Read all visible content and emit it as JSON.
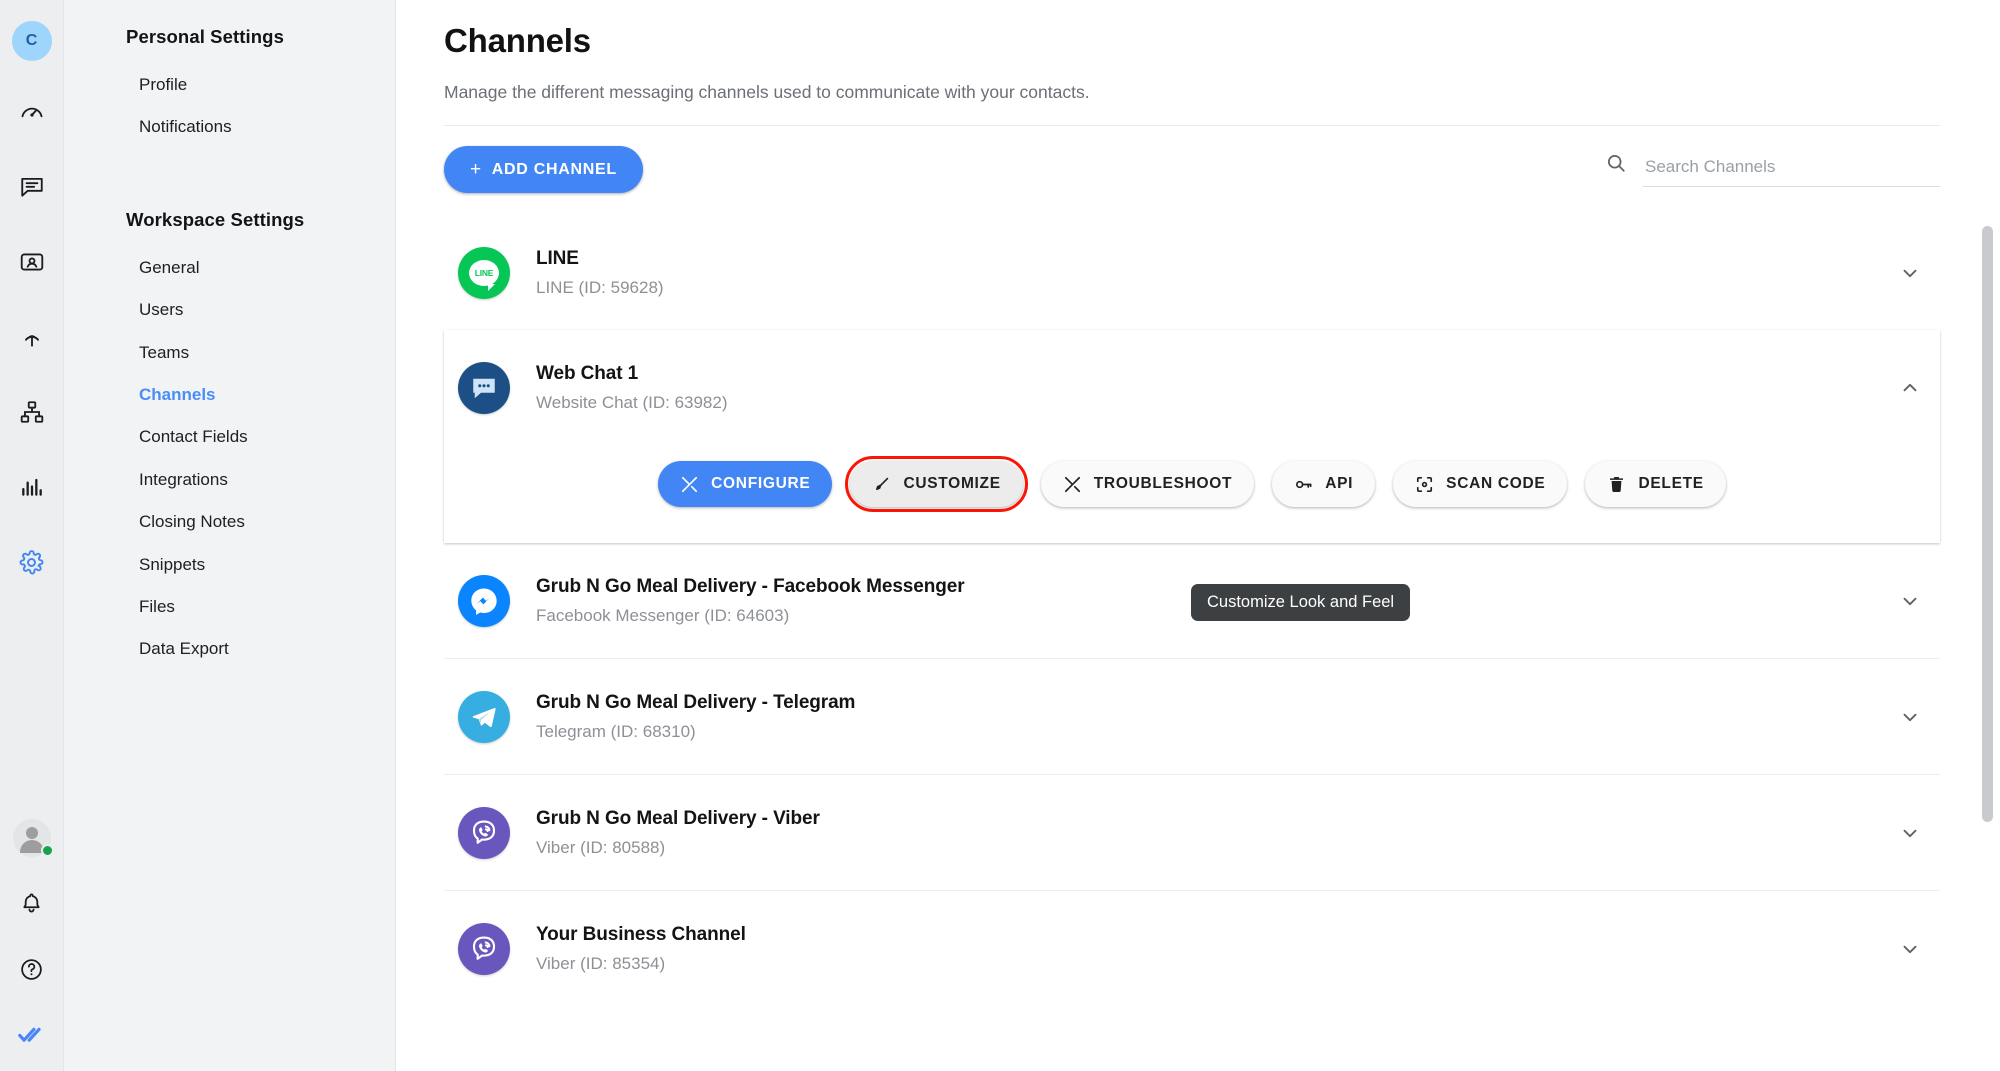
{
  "rail": {
    "avatar_initial": "C",
    "icons": [
      {
        "name": "dashboard-icon"
      },
      {
        "name": "conversations-icon"
      },
      {
        "name": "contacts-icon"
      },
      {
        "name": "broadcast-icon"
      },
      {
        "name": "workflows-icon"
      },
      {
        "name": "reports-icon"
      },
      {
        "name": "settings-icon"
      }
    ],
    "bottom_icons": [
      {
        "name": "user-status-avatar"
      },
      {
        "name": "bell-icon"
      },
      {
        "name": "help-icon"
      },
      {
        "name": "brand-logo-icon"
      }
    ],
    "accent": "#4285f4",
    "status_color": "#16a34a"
  },
  "sidebar": {
    "sections": [
      {
        "title": "Personal Settings",
        "items": [
          {
            "label": "Profile",
            "active": false
          },
          {
            "label": "Notifications",
            "active": false
          }
        ]
      },
      {
        "title": "Workspace Settings",
        "items": [
          {
            "label": "General",
            "active": false
          },
          {
            "label": "Users",
            "active": false
          },
          {
            "label": "Teams",
            "active": false
          },
          {
            "label": "Channels",
            "active": true
          },
          {
            "label": "Contact Fields",
            "active": false
          },
          {
            "label": "Integrations",
            "active": false
          },
          {
            "label": "Closing Notes",
            "active": false
          },
          {
            "label": "Snippets",
            "active": false
          },
          {
            "label": "Files",
            "active": false
          },
          {
            "label": "Data Export",
            "active": false
          }
        ]
      }
    ]
  },
  "main": {
    "title": "Channels",
    "subtitle": "Manage the different messaging channels used to communicate with your contacts.",
    "add_button": {
      "label": "ADD CHANNEL",
      "plus": "+"
    },
    "search": {
      "placeholder": "Search Channels",
      "value": "",
      "icon": "search-icon"
    }
  },
  "channels": [
    {
      "name": "LINE",
      "meta": "LINE (ID: 59628)",
      "icon": "line-icon",
      "icon_class": "ico-line",
      "expanded": false,
      "chevron": "chevron-down-icon"
    },
    {
      "name": "Web Chat 1",
      "meta": "Website Chat (ID: 63982)",
      "icon": "website-chat-icon",
      "icon_class": "ico-web",
      "expanded": true,
      "chevron": "chevron-up-icon"
    },
    {
      "name": "Grub N Go Meal Delivery - Facebook Messenger",
      "meta": "Facebook Messenger (ID: 64603)",
      "icon": "facebook-messenger-icon",
      "icon_class": "ico-fb",
      "expanded": false,
      "chevron": "chevron-down-icon"
    },
    {
      "name": "Grub N Go Meal Delivery - Telegram",
      "meta": "Telegram (ID: 68310)",
      "icon": "telegram-icon",
      "icon_class": "ico-tg",
      "expanded": false,
      "chevron": "chevron-down-icon"
    },
    {
      "name": "Grub N Go Meal Delivery - Viber",
      "meta": "Viber (ID: 80588)",
      "icon": "viber-icon",
      "icon_class": "ico-vb",
      "expanded": false,
      "chevron": "chevron-down-icon"
    },
    {
      "name": "Your Business Channel",
      "meta": "Viber (ID: 85354)",
      "icon": "viber-icon",
      "icon_class": "ico-vb",
      "expanded": false,
      "chevron": "chevron-down-icon"
    }
  ],
  "channel_actions": [
    {
      "label": "CONFIGURE",
      "icon": "tools-icon",
      "style": "primary"
    },
    {
      "label": "CUSTOMIZE",
      "icon": "brush-icon",
      "style": "highlight"
    },
    {
      "label": "TROUBLESHOOT",
      "icon": "tools-icon",
      "style": "default"
    },
    {
      "label": "API",
      "icon": "key-icon",
      "style": "default"
    },
    {
      "label": "SCAN CODE",
      "icon": "qr-scan-icon",
      "style": "default"
    },
    {
      "label": "DELETE",
      "icon": "trash-icon",
      "style": "default"
    }
  ],
  "tooltip": {
    "text": "Customize Look and Feel"
  },
  "colors": {
    "accent_blue": "#4285f4",
    "highlight_red": "#fc1404",
    "sidebar_bg": "#f2f3f5",
    "rail_bg": "#eceef0",
    "tooltip_bg": "#3c4043"
  }
}
